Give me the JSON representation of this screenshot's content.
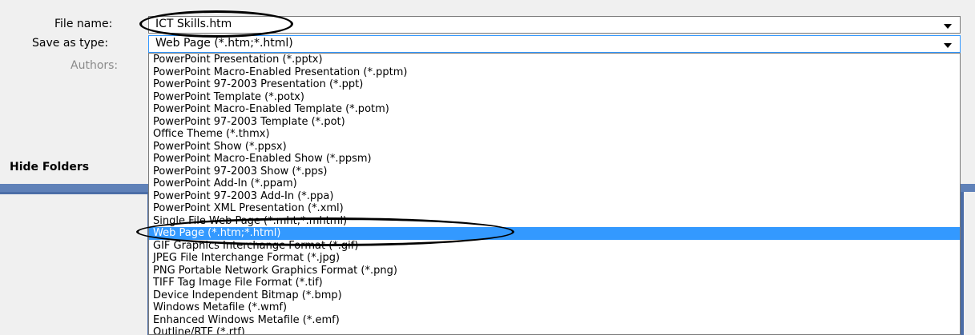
{
  "form": {
    "file_name_label": "File name:",
    "file_name_value": "ICT Skills.htm",
    "save_as_type_label": "Save as type:",
    "save_as_type_value": "Web Page (*.htm;*.html)",
    "authors_label": "Authors:",
    "hide_folders_label": "Hide Folders"
  },
  "file_types": [
    "PowerPoint Presentation (*.pptx)",
    "PowerPoint Macro-Enabled Presentation (*.pptm)",
    "PowerPoint 97-2003 Presentation (*.ppt)",
    "PowerPoint Template (*.potx)",
    "PowerPoint Macro-Enabled Template (*.potm)",
    "PowerPoint 97-2003 Template (*.pot)",
    "Office Theme (*.thmx)",
    "PowerPoint Show (*.ppsx)",
    "PowerPoint Macro-Enabled Show (*.ppsm)",
    "PowerPoint 97-2003 Show (*.pps)",
    "PowerPoint Add-In (*.ppam)",
    "PowerPoint 97-2003 Add-In (*.ppa)",
    "PowerPoint XML Presentation (*.xml)",
    "Single File Web Page (*.mht;*.mhtml)",
    "Web Page (*.htm;*.html)",
    "GIF Graphics Interchange Format (*.gif)",
    "JPEG File Interchange Format (*.jpg)",
    "PNG Portable Network Graphics Format (*.png)",
    "TIFF Tag Image File Format (*.tif)",
    "Device Independent Bitmap (*.bmp)",
    "Windows Metafile (*.wmf)",
    "Enhanced Windows Metafile (*.emf)",
    "Outline/RTF (*.rtf)"
  ],
  "selected_index": 14,
  "colors": {
    "selection": "#3399ff",
    "annotation_oval": "#000000"
  }
}
